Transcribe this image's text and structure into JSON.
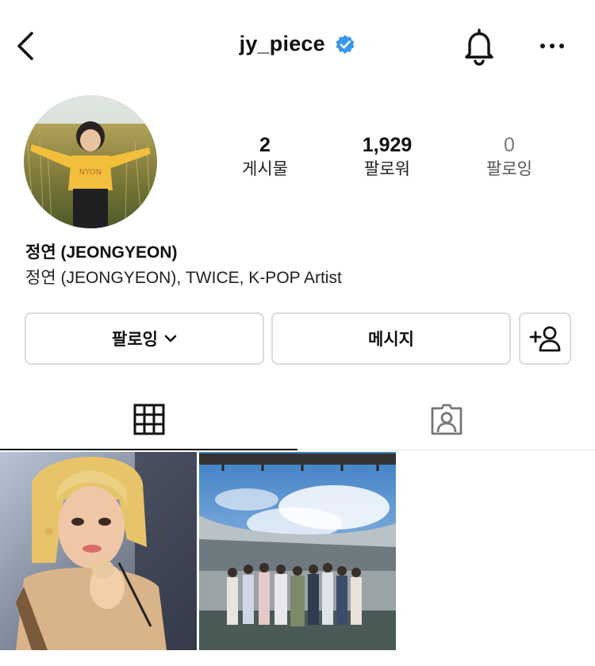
{
  "header": {
    "username": "jy_piece",
    "verified": true,
    "icons": [
      "back-arrow-icon",
      "verified-badge-icon",
      "bell-icon",
      "more-icon"
    ]
  },
  "profile": {
    "display_name": "정연 (JEONGYEON)",
    "bio": "정연 (JEONGYEON), TWICE, K-POP Artist",
    "stats": [
      {
        "value": "2",
        "label": "게시물"
      },
      {
        "value": "1,929",
        "label": "팔로워"
      },
      {
        "value": "0",
        "label": "팔로잉"
      }
    ]
  },
  "actions": {
    "follow_label": "팔로잉",
    "message_label": "메시지",
    "add_user_icon": "add-user-icon"
  },
  "tabs": [
    {
      "name": "grid",
      "icon": "grid-icon",
      "active": true
    },
    {
      "name": "tagged",
      "icon": "tagged-person-icon",
      "active": false
    }
  ],
  "posts": [
    {
      "icon": "photo-thumbnail"
    },
    {
      "icon": "photo-thumbnail"
    }
  ],
  "colors": {
    "verified": "#3897f0",
    "border": "#dbdbdb",
    "text": "#111111"
  }
}
